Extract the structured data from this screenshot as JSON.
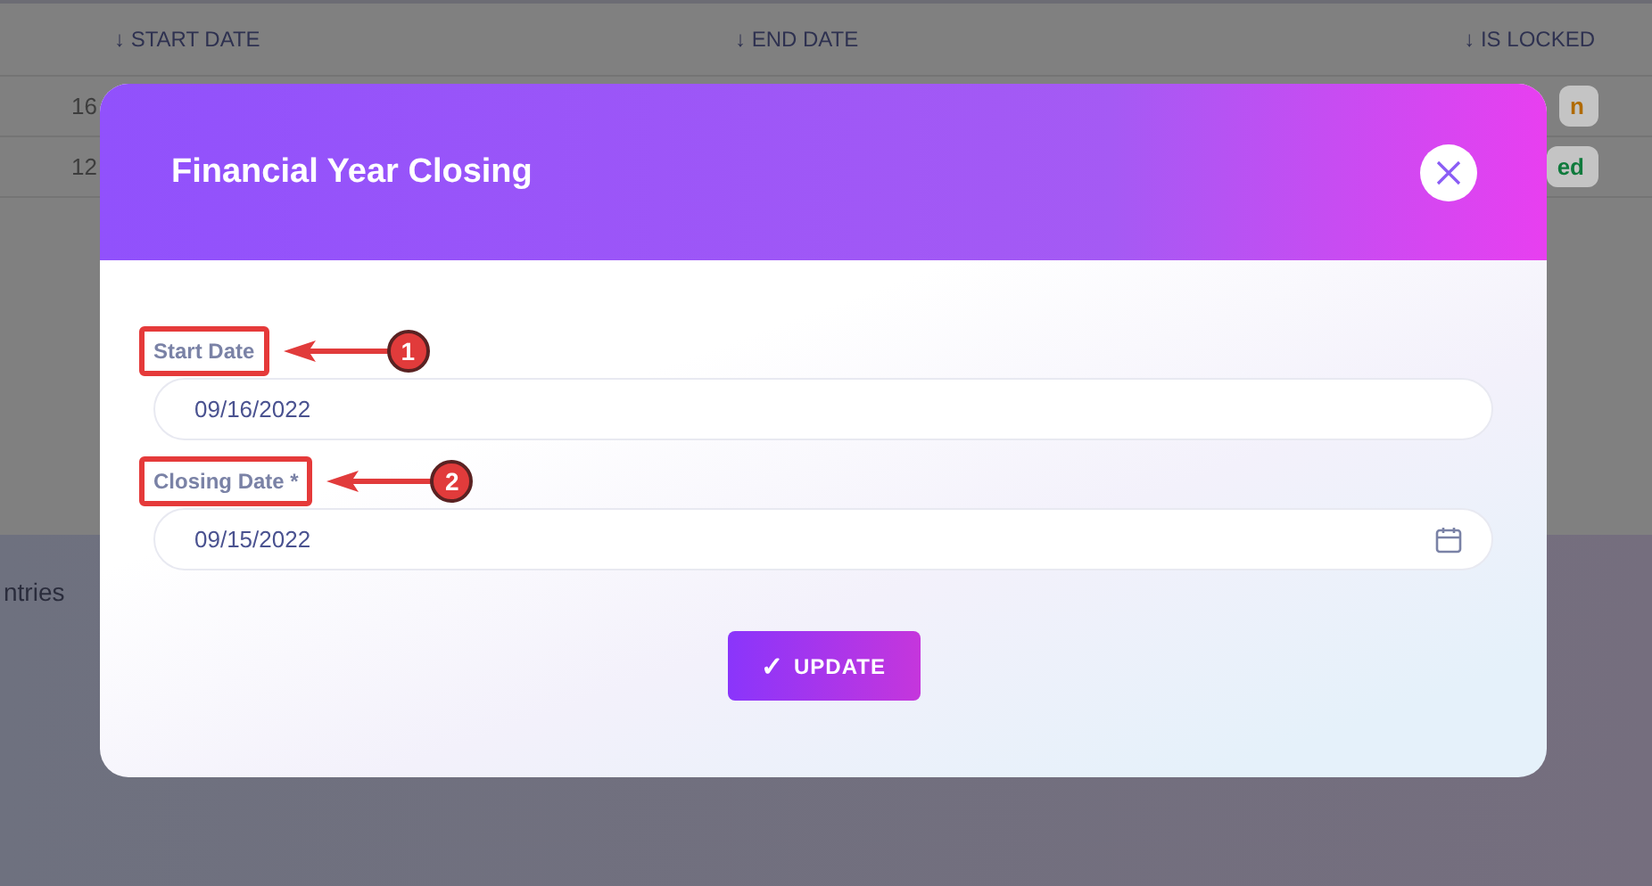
{
  "table": {
    "columns": [
      {
        "label": "↓ START DATE"
      },
      {
        "label": "↓ END DATE"
      },
      {
        "label": "↓ IS LOCKED"
      }
    ],
    "rows": [
      {
        "column_1": "16",
        "is_locked": "n",
        "color": "#b06a00"
      },
      {
        "column_1": "12",
        "is_locked": "ed",
        "color": "#0f7a3c"
      }
    ]
  },
  "footer": {
    "text": "ntries"
  },
  "modal": {
    "title": "Financial Year Closing",
    "fields": [
      {
        "label": "Start Date",
        "value": "09/16/2022",
        "calendar": false,
        "callout": "1"
      },
      {
        "label": "Closing Date *",
        "value": "09/15/2022",
        "calendar": true,
        "callout": "2"
      }
    ],
    "button": {
      "icon": "✓",
      "label": "UPDATE"
    }
  }
}
